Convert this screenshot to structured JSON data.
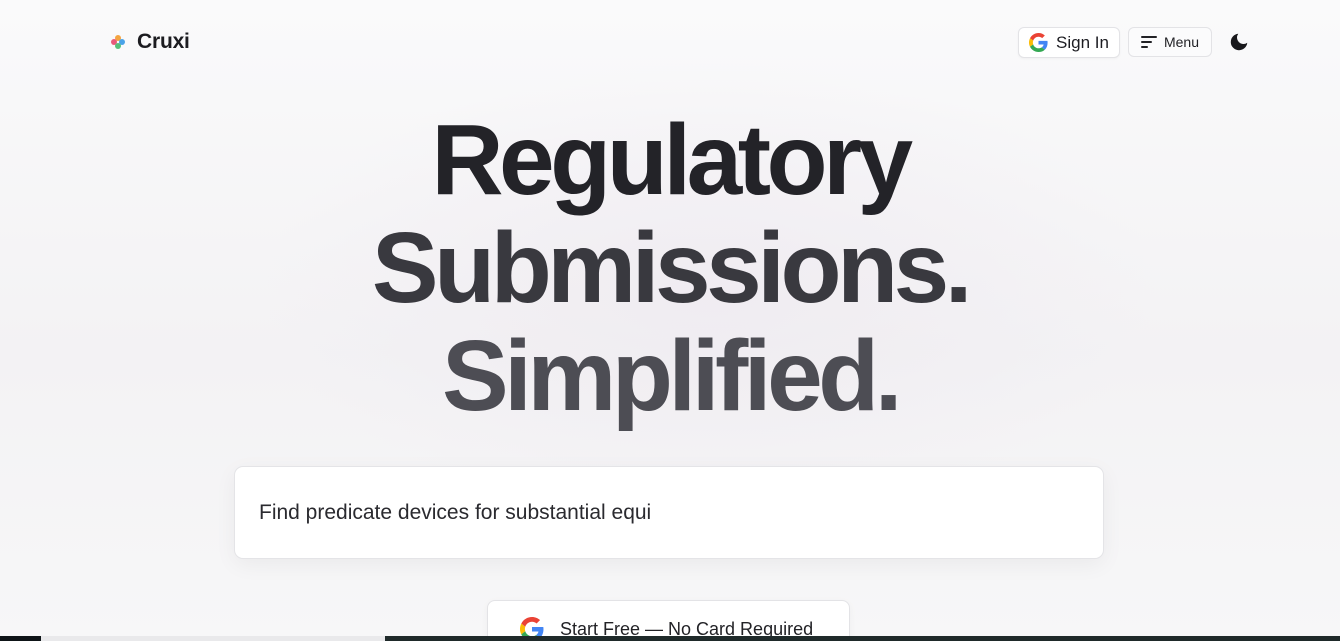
{
  "brand": {
    "name": "Cruxi",
    "logo_colors": [
      "#f4a340",
      "#e85a7a",
      "#4aa3e8",
      "#56c07a"
    ]
  },
  "header": {
    "signin_label": "Sign In",
    "signin_icon": "google-icon",
    "menu_label": "Menu",
    "menu_icon": "menu-lines-icon",
    "theme_icon": "moon-icon"
  },
  "hero": {
    "line1": "Regulatory",
    "line2": "Submissions.",
    "line3": "Simplified."
  },
  "search": {
    "value": "Find predicate devices for substantial equi"
  },
  "cta": {
    "label": "Start Free — No Card Required",
    "icon": "google-icon"
  },
  "colors": {
    "text_dark": "#232328",
    "google_blue": "#4285F4",
    "google_red": "#EA4335",
    "google_yellow": "#FBBC05",
    "google_green": "#34A853"
  }
}
